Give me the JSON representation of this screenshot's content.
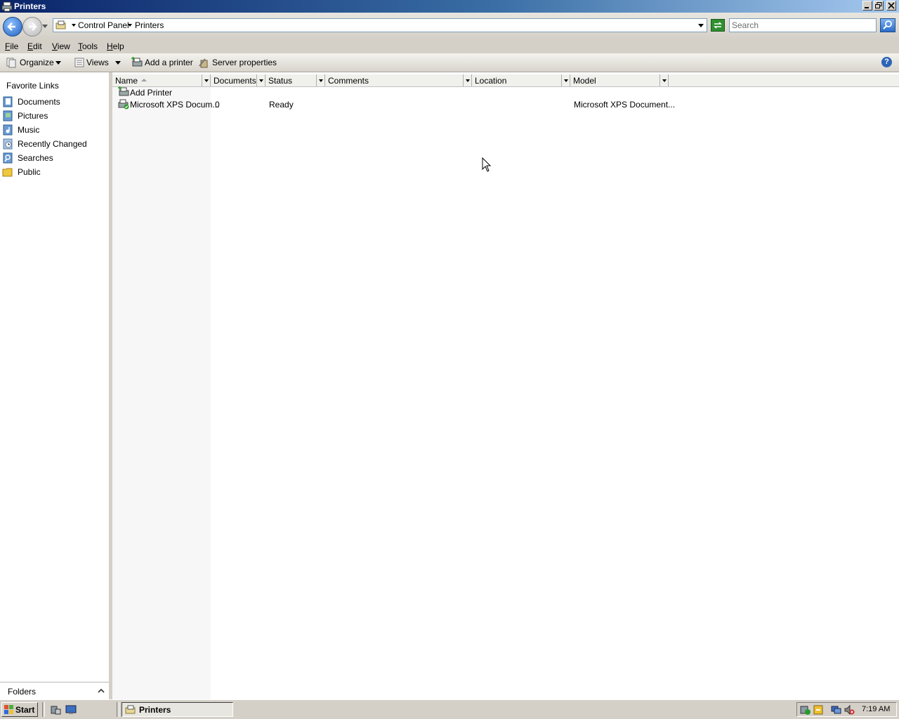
{
  "window": {
    "title": "Printers"
  },
  "address": {
    "crumbs": [
      "Control Panel",
      "Printers"
    ],
    "search_placeholder": "Search"
  },
  "menu": {
    "file": "File",
    "edit": "Edit",
    "view": "View",
    "tools": "Tools",
    "help": "Help"
  },
  "commands": {
    "organize": "Organize",
    "views": "Views",
    "add_printer": "Add a printer",
    "server_properties": "Server properties"
  },
  "nav": {
    "title": "Favorite Links",
    "links": [
      "Documents",
      "Pictures",
      "Music",
      "Recently Changed",
      "Searches",
      "Public"
    ],
    "folders": "Folders"
  },
  "columns": [
    "Name",
    "Documents",
    "Status",
    "Comments",
    "Location",
    "Model"
  ],
  "rows": [
    {
      "name": "Add Printer",
      "documents": "",
      "status": "",
      "comments": "",
      "location": "",
      "model": ""
    },
    {
      "name": "Microsoft XPS Docum...",
      "documents": "0",
      "status": "Ready",
      "comments": "",
      "location": "",
      "model": "Microsoft XPS Document..."
    }
  ],
  "taskbar": {
    "start": "Start",
    "task": "Printers",
    "clock": "7:19 AM"
  },
  "colors": {
    "titlebar_start": "#0a246a",
    "titlebar_end": "#a6caf0",
    "chrome": "#d4d0c8"
  }
}
